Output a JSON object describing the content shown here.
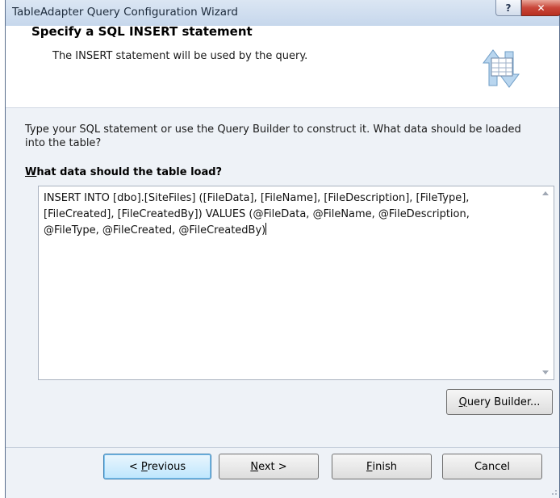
{
  "window": {
    "title": "TableAdapter Query Configuration Wizard"
  },
  "titlebar_buttons": {
    "help_glyph": "?",
    "close_glyph": "✕"
  },
  "header": {
    "title": "Specify a SQL INSERT statement",
    "subtitle": "The INSERT statement will be used by the query.",
    "icon": "table-update-icon"
  },
  "intro": "Type your SQL statement or use the Query Builder to construct it. What data should be loaded into the table?",
  "field": {
    "label_accel": "W",
    "label_rest": "hat data should the table load?"
  },
  "sql": {
    "line1": "INSERT INTO [dbo].[SiteFiles] ([FileData], [FileName], [FileDescription], [FileType],",
    "line2": "[FileCreated], [FileCreatedBy]) VALUES (@FileData, @FileName, @FileDescription,",
    "line3": "@FileType, @FileCreated, @FileCreatedBy)"
  },
  "query_builder": {
    "accel": "Q",
    "rest": "uery Builder..."
  },
  "buttons": {
    "previous": {
      "pre": "< ",
      "accel": "P",
      "rest": "revious"
    },
    "next": {
      "accel": "N",
      "rest": "ext >"
    },
    "finish": {
      "accel": "F",
      "rest": "inish"
    },
    "cancel": "Cancel"
  },
  "colors": {
    "accent": "#3c7fb1",
    "close": "#c9473a",
    "panel": "#eef2f7"
  }
}
